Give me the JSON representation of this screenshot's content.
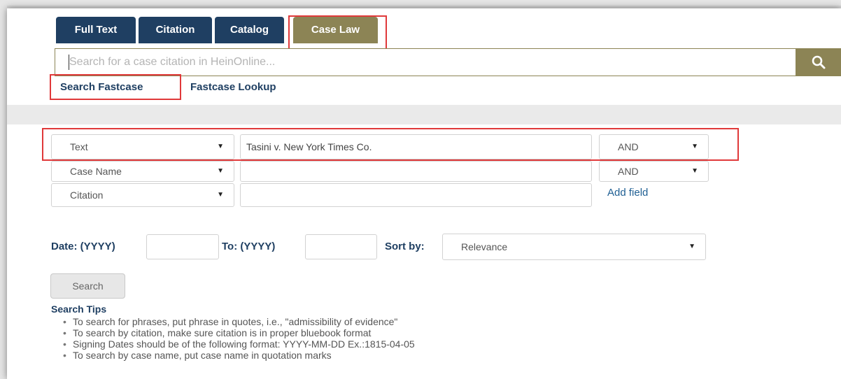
{
  "tabs": [
    {
      "label": "Full Text",
      "active": false
    },
    {
      "label": "Citation",
      "active": false
    },
    {
      "label": "Catalog",
      "active": false
    },
    {
      "label": "Case Law",
      "active": true
    }
  ],
  "search": {
    "placeholder": "Search for a case citation in HeinOnline...",
    "button_icon": "search-icon"
  },
  "links": {
    "search_fastcase": "Search Fastcase",
    "fastcase_lookup": "Fastcase Lookup"
  },
  "rows": [
    {
      "field": "Text",
      "value": "Tasini v. New York Times Co.",
      "operator": "AND"
    },
    {
      "field": "Case Name",
      "value": "",
      "operator": "AND"
    },
    {
      "field": "Citation",
      "value": ""
    }
  ],
  "add_field_label": "Add field",
  "date": {
    "from_label": "Date: (YYYY)",
    "to_label": "To: (YYYY)",
    "from_value": "",
    "to_value": ""
  },
  "sort": {
    "label": "Sort by:",
    "value": "Relevance"
  },
  "search_button_label": "Search",
  "tips": {
    "title": "Search Tips",
    "items": [
      "To search for phrases, put phrase in quotes, i.e., \"admissibility of evidence\"",
      "To search by citation, make sure citation is in proper bluebook format",
      "Signing Dates should be of the following format: YYYY-MM-DD Ex.:1815-04-05",
      "To search by case name, put case name in quotation marks"
    ]
  },
  "colors": {
    "navy": "#1f3f62",
    "olive": "#8c8455",
    "highlight": "#e0393a"
  }
}
